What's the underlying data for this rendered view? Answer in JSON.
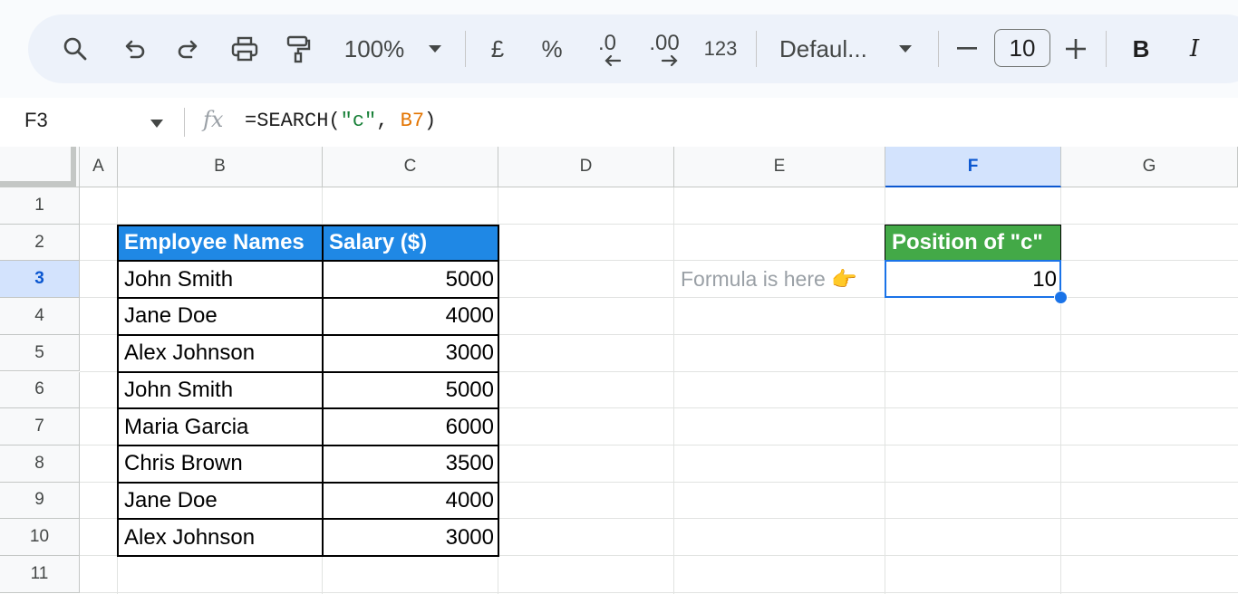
{
  "toolbar": {
    "zoom": "100%",
    "currency": "£",
    "percent": "%",
    "decrease_decimal": ".0",
    "increase_decimal": ".00",
    "number_format": "123",
    "font": "Defaul...",
    "font_size": "10",
    "bold": "B",
    "italic": "I"
  },
  "formula_bar": {
    "cell_ref": "F3",
    "fx": "fx",
    "formula_prefix": "=SEARCH(",
    "formula_string": "\"c\"",
    "formula_comma": ", ",
    "formula_ref": "B7",
    "formula_suffix": ")"
  },
  "columns": [
    "A",
    "B",
    "C",
    "D",
    "E",
    "F",
    "G"
  ],
  "selected_column": "F",
  "rows": [
    "1",
    "2",
    "3",
    "4",
    "5",
    "6",
    "7",
    "8",
    "9",
    "10",
    "11"
  ],
  "selected_row": "3",
  "table": {
    "headers": [
      "Employee Names",
      "Salary ($)"
    ],
    "rows": [
      {
        "name": "John Smith",
        "salary": "5000"
      },
      {
        "name": "Jane Doe",
        "salary": "4000"
      },
      {
        "name": "Alex Johnson",
        "salary": "3000"
      },
      {
        "name": "John Smith",
        "salary": "5000"
      },
      {
        "name": "Maria Garcia",
        "salary": "6000"
      },
      {
        "name": "Chris Brown",
        "salary": "3500"
      },
      {
        "name": "Jane Doe",
        "salary": "4000"
      },
      {
        "name": "Alex Johnson",
        "salary": "3000"
      }
    ]
  },
  "result": {
    "header": "Position of \"c\"",
    "value": "10",
    "note": "Formula is here 👉"
  },
  "colors": {
    "table_header": "#1f88e5",
    "result_header": "#43a947",
    "selection": "#1a73e8"
  }
}
